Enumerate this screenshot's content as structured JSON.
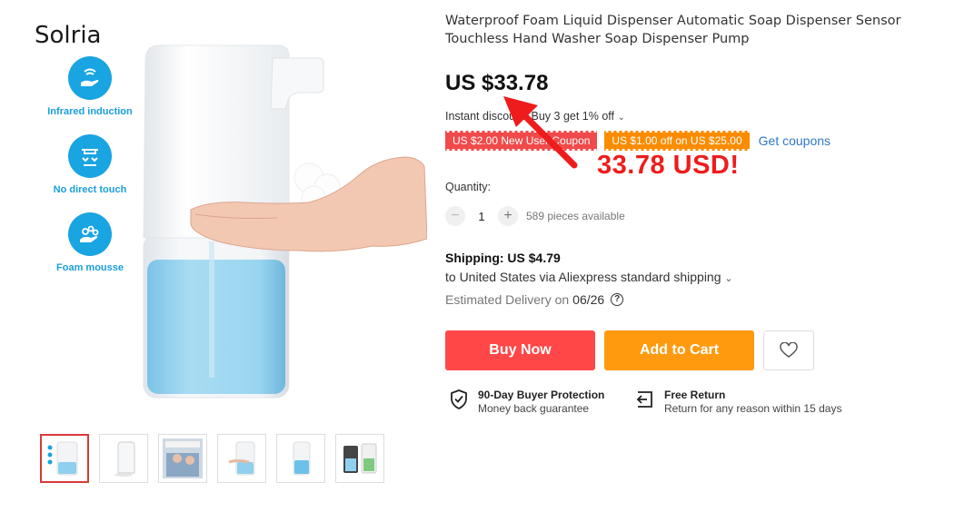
{
  "gallery": {
    "brand": "Solria",
    "features": [
      {
        "label": "Infrared induction",
        "icon": "infrared-icon"
      },
      {
        "label": "No direct touch",
        "icon": "no-touch-icon"
      },
      {
        "label": "Foam mousse",
        "icon": "foam-icon"
      }
    ],
    "thumbnails_count": 6,
    "active_thumbnail": 1
  },
  "product": {
    "title": "Waterproof Foam Liquid Dispenser Automatic Soap Dispenser Sensor Touchless Hand Washer Soap Dispenser Pump",
    "price": "US $33.78",
    "instant_discount": "Instant discount: Buy 3 get 1% off",
    "coupons": [
      {
        "label": "US $2.00 New User Coupon",
        "color": "#f04a4a"
      },
      {
        "label": "US $1.00 off on US $25.00",
        "color": "#fb8c00"
      }
    ],
    "get_coupons": "Get coupons",
    "annotation": "33.78 USD!",
    "annotation_color": "#ee1c1c"
  },
  "quantity": {
    "label": "Quantity:",
    "value": "1",
    "available": "589 pieces available"
  },
  "shipping": {
    "title": "Shipping: US $4.79",
    "via": "to United States via Aliexpress standard shipping",
    "estimated_label": "Estimated Delivery on",
    "estimated_date": "06/26"
  },
  "actions": {
    "buy_now": "Buy Now",
    "add_to_cart": "Add to Cart",
    "buy_color": "#ff4747",
    "cart_color": "#ff9a0e"
  },
  "protection": {
    "buyer_title": "90-Day Buyer Protection",
    "buyer_sub": "Money back guarantee",
    "return_title": "Free Return",
    "return_sub": "Return for any reason within 15 days"
  }
}
